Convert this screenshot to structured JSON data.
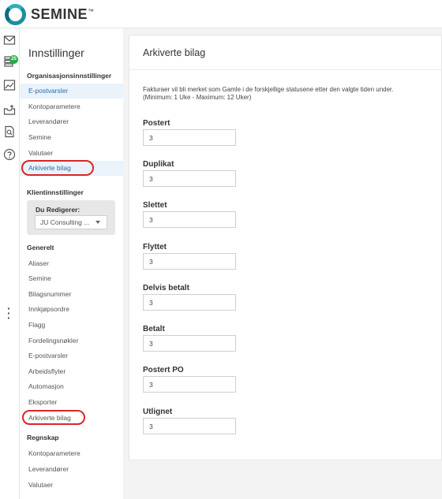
{
  "app": {
    "logo_text": "SEMINE",
    "logo_tm": "™"
  },
  "rail": {
    "badge": "25",
    "icons": [
      "mail-icon",
      "documents-icon",
      "chart-icon",
      "inbox-icon",
      "search-document-icon",
      "help-icon"
    ]
  },
  "sidebar": {
    "title": "Innstillinger",
    "org_section": "Organisasjonsinnstillinger",
    "org_items": [
      "E-postvarsler",
      "Kontoparametere",
      "Leverandører",
      "Semine",
      "Valutaer",
      "Arkiverte bilag"
    ],
    "client_section": "Klientinnstillinger",
    "editor_label": "Du Redigerer:",
    "editor_value": "JU Consulting ...",
    "general_group": "Generelt",
    "general_items": [
      "Aliaser",
      "Semine",
      "Bilagsnummer",
      "Innkjøpsordre",
      "Flagg",
      "Fordelingsnøkler",
      "E-postvarsler",
      "Arbeidsflyter",
      "Automasjon",
      "Eksporter",
      "Arkiverte bilag"
    ],
    "accounting_group": "Regnskap",
    "accounting_items": [
      "Kontoparametere",
      "Leverandører",
      "Valutaer"
    ]
  },
  "main": {
    "title": "Arkiverte bilag",
    "description_line1": "Fakturaer vil bli merket som Gamle i de forskjellige statusene etter den valgte tiden under.",
    "description_line2": "(Minimum: 1 Uke - Maximum: 12 Uker)",
    "fields": [
      {
        "label": "Postert",
        "value": "3"
      },
      {
        "label": "Duplikat",
        "value": "3"
      },
      {
        "label": "Slettet",
        "value": "3"
      },
      {
        "label": "Flyttet",
        "value": "3"
      },
      {
        "label": "Delvis betalt",
        "value": "3"
      },
      {
        "label": "Betalt",
        "value": "3"
      },
      {
        "label": "Postert PO",
        "value": "3"
      },
      {
        "label": "Utlignet",
        "value": "3"
      }
    ]
  },
  "colors": {
    "accent": "#1a8fa0",
    "active_bg": "#eaf2fa",
    "active_text": "#2d6da8",
    "highlight_ring": "#d9262b",
    "badge": "#2aa84a"
  }
}
